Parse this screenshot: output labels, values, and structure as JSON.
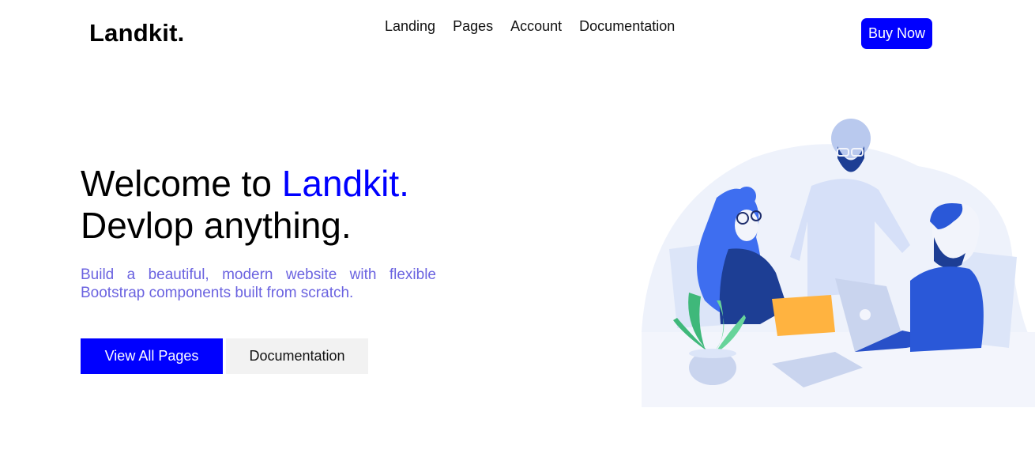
{
  "header": {
    "logo": "Landkit.",
    "nav": [
      "Landing",
      "Pages",
      "Account",
      "Documentation"
    ],
    "buy_label": "Buy Now"
  },
  "hero": {
    "title_part1": "Welcome to ",
    "title_brand": "Landkit.",
    "title_line2": "Devlop anything.",
    "subtitle": "Build a beautiful, modern website with flexible Bootstrap components built from scratch.",
    "primary_label": "View All Pages",
    "secondary_label": "Documentation"
  },
  "colors": {
    "accent": "#0000ff",
    "subtitle": "#6b63e0",
    "secondary_bg": "#f2f2f2"
  },
  "illustration": {
    "icon": "team-working-illustration"
  }
}
